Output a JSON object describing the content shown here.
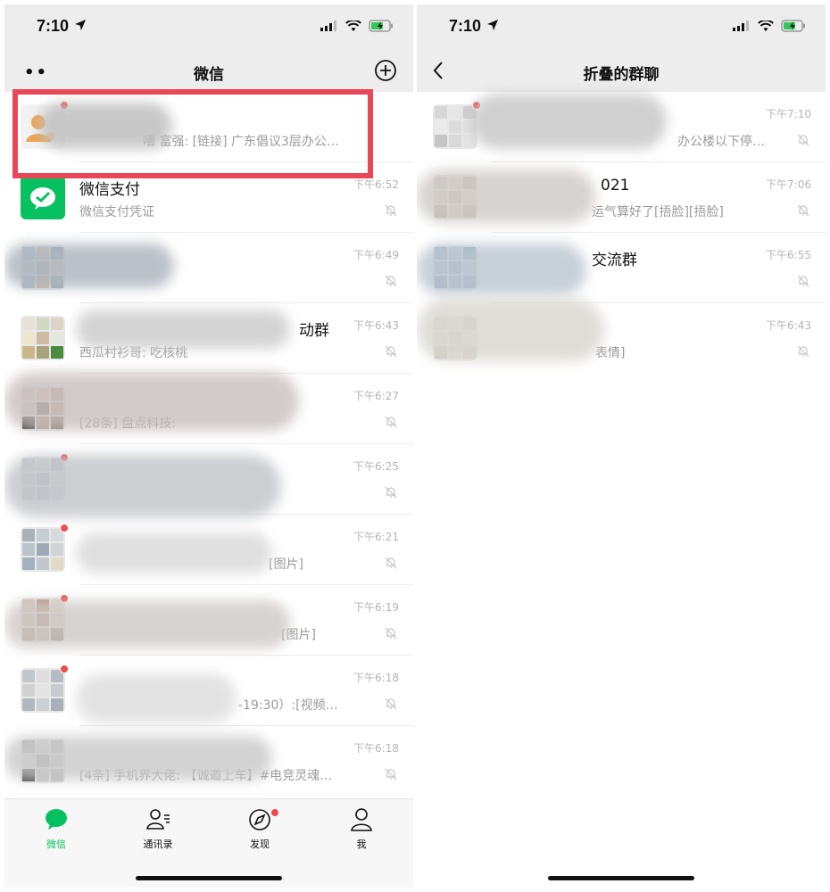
{
  "left_screen": {
    "status_bar": {
      "time": "7:10"
    },
    "nav": {
      "title": "微信",
      "more_icon": "more-dots-icon",
      "add_icon": "plus-circle-icon"
    },
    "chats": [
      {
        "name": "",
        "preview": "嘈 富强: [链接] 广东倡议3层办公…",
        "time": "",
        "muted": false,
        "highlighted": true
      },
      {
        "name": "微信支付",
        "preview": "微信支付凭证",
        "time": "下午6:52",
        "muted": true
      },
      {
        "name": "",
        "preview": "",
        "time": "下午6:49",
        "muted": true
      },
      {
        "name": "动群",
        "preview": "西瓜村衫哥: 吃核桃",
        "time": "下午6:43",
        "muted": true
      },
      {
        "name": "",
        "preview": "[28条] 盘点科技:",
        "time": "下午6:27",
        "muted": true
      },
      {
        "name": "",
        "preview": "",
        "time": "下午6:25",
        "muted": true
      },
      {
        "name": "",
        "preview": "[图片]",
        "time": "下午6:21",
        "muted": true
      },
      {
        "name": "",
        "preview": "[图片]",
        "time": "下午6:19",
        "muted": true
      },
      {
        "name": "",
        "preview": "-19:30）:[视频…",
        "time": "下午6:18",
        "muted": true
      },
      {
        "name": "",
        "preview": "[4条] 手机界大佬: 【诚邀上车】#电竞灵魂…",
        "time": "下午6:18",
        "muted": true
      }
    ],
    "tabs": [
      {
        "label": "微信",
        "icon": "chat-bubble-icon",
        "active": true
      },
      {
        "label": "通讯录",
        "icon": "contacts-icon",
        "active": false
      },
      {
        "label": "发现",
        "icon": "compass-icon",
        "active": false,
        "badge": true
      },
      {
        "label": "我",
        "icon": "profile-icon",
        "active": false
      }
    ]
  },
  "right_screen": {
    "status_bar": {
      "time": "7:10"
    },
    "nav": {
      "title": "折叠的群聊",
      "back_icon": "back-chevron-icon"
    },
    "chats": [
      {
        "name": "",
        "preview": "办公楼以下停…",
        "time": "下午7:10",
        "muted": true
      },
      {
        "name": "021",
        "preview": "运气算好了[捂脸][捂脸]",
        "time": "下午7:06",
        "muted": true
      },
      {
        "name": "交流群",
        "preview": "",
        "time": "下午6:55",
        "muted": true
      },
      {
        "name": "",
        "preview": "表情]",
        "time": "下午6:43",
        "muted": true
      }
    ]
  },
  "colors": {
    "accent_green": "#07c160",
    "highlight_red": "#e94658",
    "badge_red": "#f04a4a",
    "nav_bg": "#ededed"
  }
}
